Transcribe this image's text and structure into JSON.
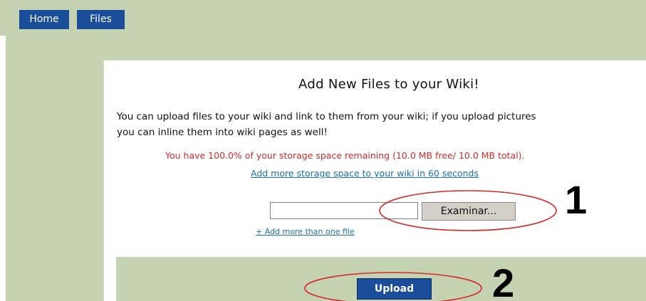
{
  "nav": {
    "home_label": "Home",
    "files_label": "Files"
  },
  "main": {
    "title": "Add New Files to your Wiki!",
    "description_line1": "You can upload files to your wiki and link to them from your wiki; if you upload pictures",
    "description_line2": "you can inline them into wiki pages as well!",
    "storage_text": "You have 100.0% of your storage space remaining (10.0 MB free/ 10.0 MB total).",
    "more_storage_link": "Add more storage space to your wiki in 60 seconds",
    "file_input_value": "",
    "browse_label": "Examinar...",
    "add_more_link": "+ Add more than one file",
    "upload_label": "Upload"
  },
  "annotations": {
    "step1": "1",
    "step2": "2",
    "ellipse_color": "#d42a2a"
  },
  "colors": {
    "nav_bg": "#c6d3b3",
    "tab_bg": "#1a4d9a",
    "storage_text": "#d22b2b",
    "link": "#1a6fb5"
  }
}
